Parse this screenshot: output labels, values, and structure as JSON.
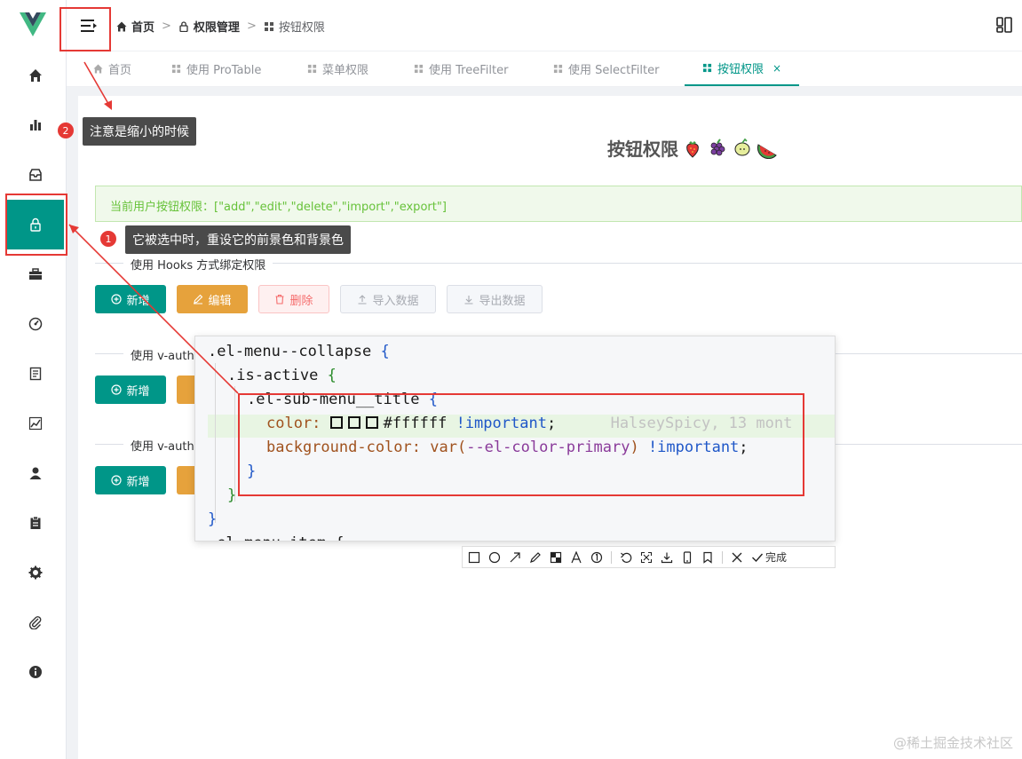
{
  "breadcrumb": {
    "home": "首页",
    "perm": "权限管理",
    "current": "按钮权限"
  },
  "tabs": [
    "首页",
    "使用 ProTable",
    "菜单权限",
    "使用 TreeFilter",
    "使用 SelectFilter",
    "按钮权限"
  ],
  "tab_close": "×",
  "page_title": "按钮权限",
  "alert_text": "当前用户按钮权限：[\"add\",\"edit\",\"delete\",\"import\",\"export\"]",
  "sections": {
    "hooks": "使用 Hooks 方式绑定权限",
    "auth1": "使用 v-auth",
    "auth2": "使用 v-auth"
  },
  "buttons": {
    "add": "新增",
    "edit": "编辑",
    "delete": "删除",
    "import": "导入数据",
    "export": "导出数据"
  },
  "annotations": {
    "note1_badge": "1",
    "note1": "它被选中时，重设它的前景色和背景色",
    "note2_badge": "2",
    "note2": "注意是缩小的时候"
  },
  "code": {
    "l1a": ".el-menu--collapse",
    "l1b": "{",
    "l2a": ".is-active",
    "l2b": "{",
    "l3a": ".el-sub-menu__title",
    "l3b": "{",
    "l4prop": "color:",
    "l4val": "#ffffff",
    "l4imp": "!important",
    "l4semi": ";",
    "l4ghost": "HalseySpicy, 13 mont",
    "l5prop": "background-color:",
    "l5fn": "var(",
    "l5var": "--el-color-primary",
    "l5close": ")",
    "l5imp": "!important",
    "l5semi": ";",
    "l6": "}",
    "l7": "}",
    "l8": "}",
    "l9": ".el-menu-item {"
  },
  "toolbar_done": "完成",
  "watermark": "@稀土掘金技术社区",
  "colors": {
    "primary": "#009688",
    "warning": "#e6a23c",
    "danger": "#f56c6c",
    "annotation": "#e53935"
  }
}
